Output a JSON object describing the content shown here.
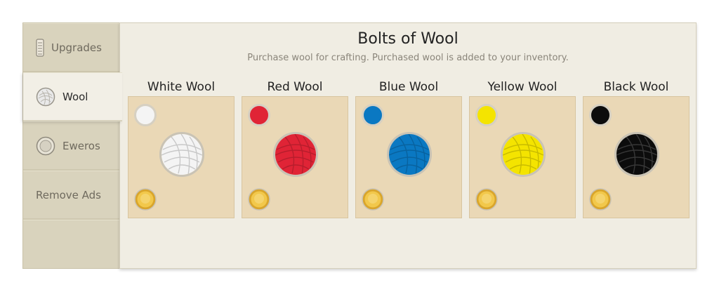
{
  "sidebar": {
    "tabs": [
      {
        "label": "Upgrades",
        "icon": "ladder-icon",
        "active": false
      },
      {
        "label": "Wool",
        "icon": "wool-ball-icon",
        "active": true
      },
      {
        "label": "Eweros",
        "icon": "eweros-coin-icon",
        "active": false
      },
      {
        "label": "Remove Ads",
        "icon": "",
        "active": false
      }
    ]
  },
  "panel": {
    "title": "Bolts of Wool",
    "subtitle": "Purchase wool for crafting. Purchased wool is added to your inventory."
  },
  "wools": [
    {
      "name": "White Wool",
      "color": "#f4f4f4"
    },
    {
      "name": "Red Wool",
      "color": "#e02436"
    },
    {
      "name": "Blue Wool",
      "color": "#0a78c2"
    },
    {
      "name": "Yellow Wool",
      "color": "#f4e400"
    },
    {
      "name": "Black Wool",
      "color": "#0c0c0c"
    }
  ],
  "colors": {
    "gold_coin": "#f2c84b",
    "card_bg": "#ead8b6"
  }
}
